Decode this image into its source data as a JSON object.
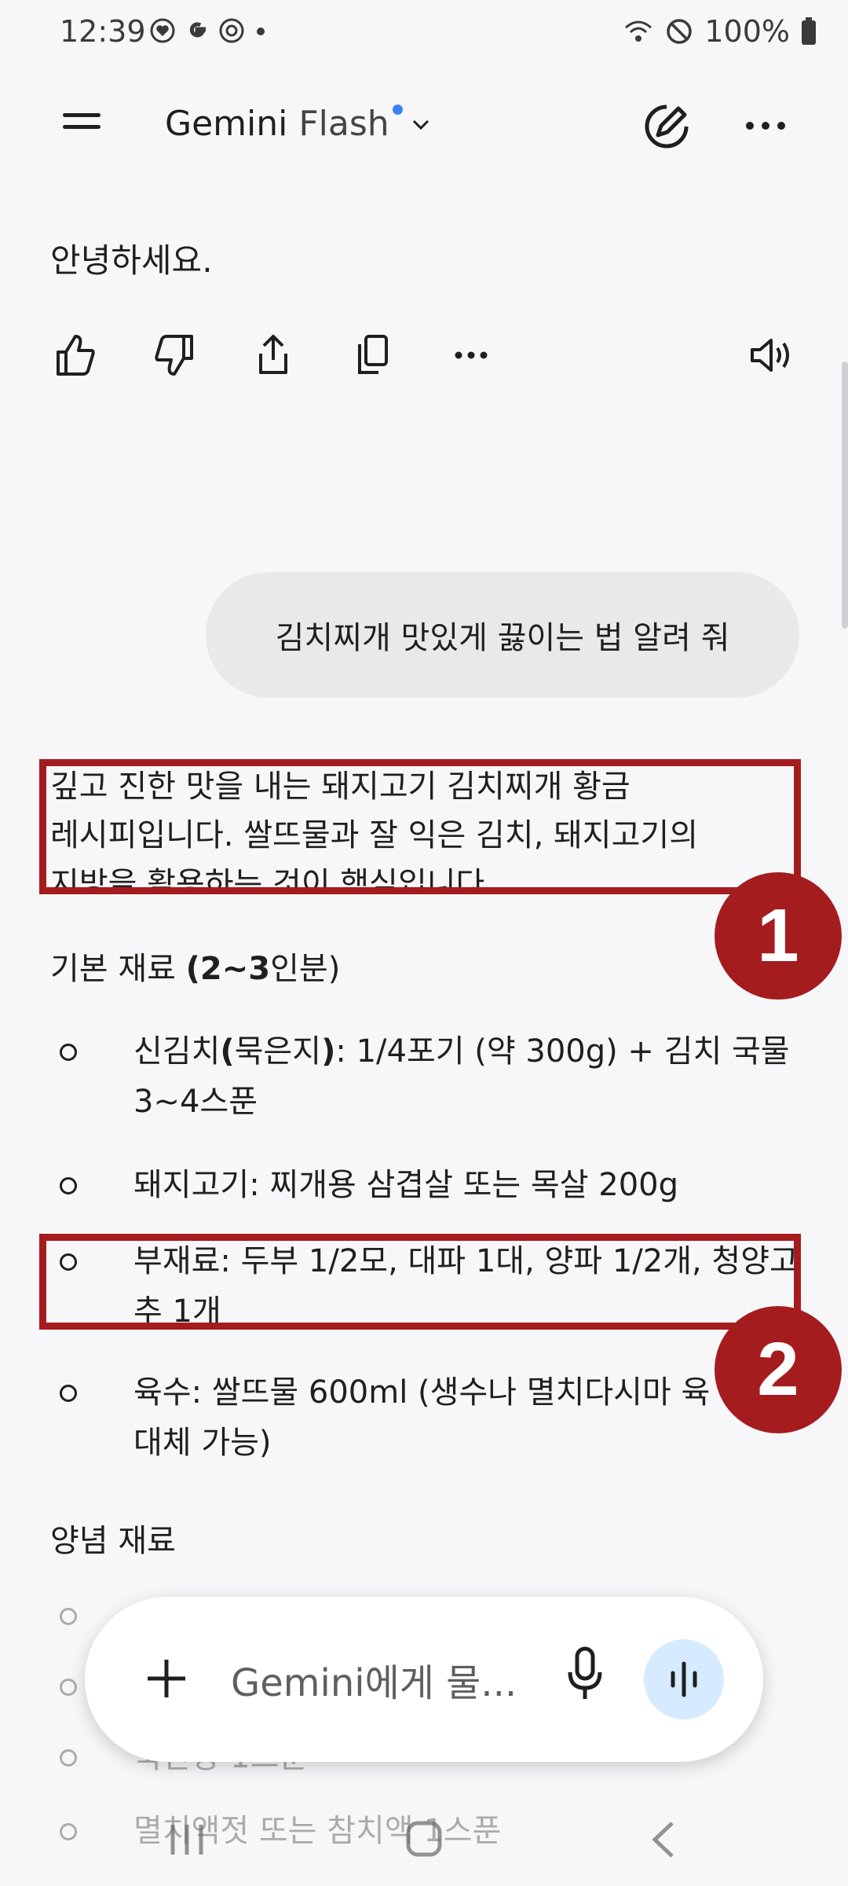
{
  "status_bar": {
    "time": "12:39",
    "battery": "100%",
    "icons": [
      "heart-app-icon",
      "google-g-icon",
      "target-app-icon",
      "notification-dot-icon",
      "wifi-icon",
      "do-not-disturb-icon",
      "battery-icon"
    ]
  },
  "header": {
    "model_name": "Gemini",
    "model_variant": "Flash",
    "menu_icon": "hamburger-icon",
    "new_chat_icon": "edit-pen-icon",
    "more_icon": "more-horizontal-icon"
  },
  "previous_response": {
    "text": "안녕하세요."
  },
  "action_icons": [
    "thumbs-up-icon",
    "thumbs-down-icon",
    "share-icon",
    "copy-icon",
    "more-icon",
    "speaker-icon"
  ],
  "user_message": "김치찌개 맛있게 끓이는 법 알려 줘",
  "response": {
    "intro_line1": "깊고 진한 맛을 내는 돼지고기 김치찌개 황금",
    "intro_line2": "레시피입니다. 쌀뜨물과 잘 익은 김치, 돼지고기의",
    "intro_line3": "지방을 활용하는 것이 핵심입니다.",
    "basic_heading_prefix": "기본 재료 ",
    "basic_heading_bold": "(2~3",
    "basic_heading_suffix": "인분)",
    "items": [
      {
        "line1_prefix": "신김치",
        "line1_bold": "(",
        "line1_mid": "묵은지",
        "line1_bold2": ")",
        "line1_rest": ": 1/4포기 (약 300g) + 김치 국물",
        "line2": "3~4스푼"
      },
      {
        "line1": "돼지고기: 찌개용 삼겹살 또는 목살 200g"
      },
      {
        "line1": "부재료: 두부 1/2모, 대파 1대, 양파 1/2개, 청양고",
        "line2": "추 1개"
      },
      {
        "line1": "육수: 쌀뜨물 600ml (생수나 멸치다시마 육",
        "line2": "대체 가능)"
      }
    ],
    "seasoning_heading": "양념 재료",
    "seasoning_items": [
      "국간장 1스푼",
      "멸치액젓 또는 참치액 1스푼"
    ]
  },
  "annotations": {
    "badge1": "1",
    "badge2": "2",
    "color": "#a51c1f"
  },
  "input": {
    "placeholder": "Gemini에게 물...",
    "add_icon": "plus-icon",
    "mic_icon": "microphone-icon",
    "live_icon": "live-waveform-icon"
  },
  "nav_bar": [
    "recents-icon",
    "home-icon",
    "back-icon"
  ]
}
